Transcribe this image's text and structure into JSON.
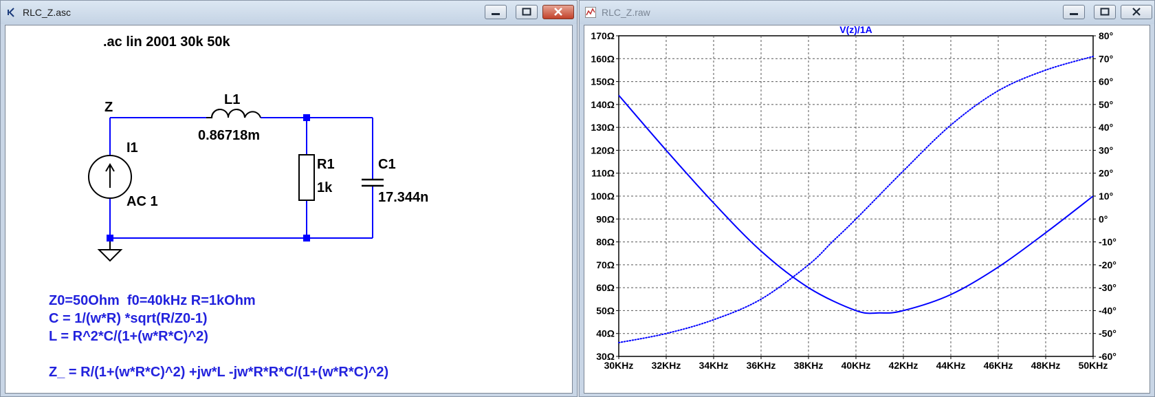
{
  "schematic_window": {
    "title": "RLC_Z.asc",
    "directive": ".ac lin 2001 30k 50k",
    "net_label": "Z",
    "inductor": {
      "name": "L1",
      "value": "0.86718m"
    },
    "source": {
      "name": "I1",
      "value": "AC 1"
    },
    "resistor": {
      "name": "R1",
      "value": "1k"
    },
    "capacitor": {
      "name": "C1",
      "value": "17.344n"
    },
    "comments": [
      "Z0=50Ohm  f0=40kHz R=1kOhm",
      "C = 1/(w*R) *sqrt(R/Z0-1)",
      "L = R^2*C/(1+(w*R*C)^2)",
      "Z_ = R/(1+(w*R*C)^2) +jw*L -jw*R*R*C/(1+(w*R*C)^2)"
    ]
  },
  "plot_window": {
    "title": "RLC_Z.raw"
  },
  "colors": {
    "wire": "#0000ff",
    "trace": "#0000ff",
    "close_button": "#c2412a"
  },
  "chart_data": {
    "type": "line",
    "title": "V(z)/1A",
    "x_tick_labels": [
      "30KHz",
      "32KHz",
      "34KHz",
      "36KHz",
      "38KHz",
      "40KHz",
      "42KHz",
      "44KHz",
      "46KHz",
      "48KHz",
      "50KHz"
    ],
    "y_left_tick_labels": [
      "170Ω",
      "160Ω",
      "150Ω",
      "140Ω",
      "130Ω",
      "120Ω",
      "110Ω",
      "100Ω",
      "90Ω",
      "80Ω",
      "70Ω",
      "60Ω",
      "50Ω",
      "40Ω",
      "30Ω"
    ],
    "y_right_tick_labels": [
      "80°",
      "70°",
      "60°",
      "50°",
      "40°",
      "30°",
      "20°",
      "10°",
      "0°",
      "-10°",
      "-20°",
      "-30°",
      "-40°",
      "-50°",
      "-60°"
    ],
    "xlim": [
      30,
      50
    ],
    "ylim_left": [
      30,
      170
    ],
    "ylim_right": [
      -60,
      80
    ],
    "x_unit": "kHz",
    "grid": true,
    "series": [
      {
        "axis": "left",
        "style": "solid",
        "x": [
          30,
          32,
          34,
          36,
          38,
          40,
          41,
          42,
          44,
          46,
          48,
          50
        ],
        "values": [
          144,
          120,
          97,
          76,
          60,
          50,
          49,
          50,
          57,
          69,
          84,
          100
        ]
      },
      {
        "axis": "right",
        "style": "dotted",
        "x": [
          30,
          32,
          34,
          36,
          38,
          39,
          40,
          42,
          44,
          46,
          48,
          50
        ],
        "values": [
          -54,
          -50,
          -44,
          -35,
          -20,
          -10,
          0,
          21,
          41,
          56,
          65,
          71
        ]
      }
    ]
  }
}
